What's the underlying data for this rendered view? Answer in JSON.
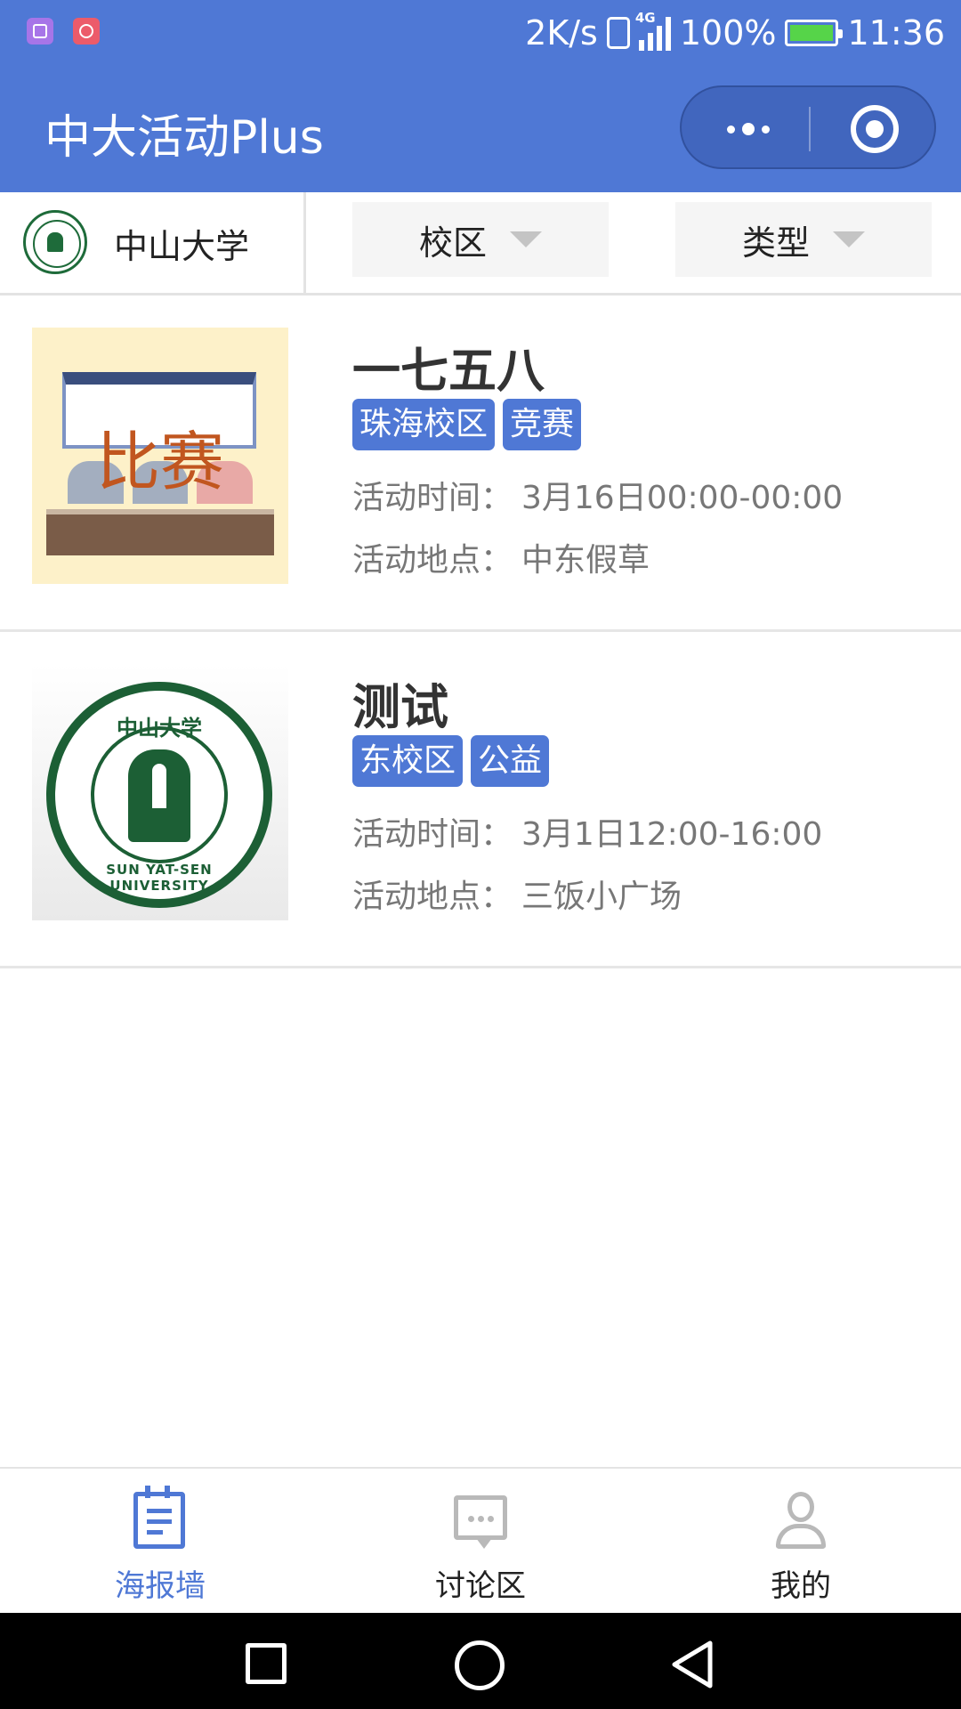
{
  "status_bar": {
    "speed": "2K/s",
    "network": "4G",
    "battery": "100%",
    "time": "11:36"
  },
  "nav_bar": {
    "title": "中大活动Plus"
  },
  "filter_bar": {
    "school": "中山大学",
    "campus_label": "校区",
    "type_label": "类型"
  },
  "events": [
    {
      "title": "一七五八",
      "tags": [
        "珠海校区",
        "竞赛"
      ],
      "time_label": "活动时间：",
      "time_value": "3月16日00:00-00:00",
      "place_label": "活动地点：",
      "place_value": "中东假草",
      "thumbnail_text": "比赛"
    },
    {
      "title": "测试",
      "tags": [
        "东校区",
        "公益"
      ],
      "time_label": "活动时间：",
      "time_value": "3月1日12:00-16:00",
      "place_label": "活动地点：",
      "place_value": "三饭小广场",
      "thumbnail_text_top": "中山大学",
      "thumbnail_text_bottom": "SUN YAT-SEN UNIVERSITY"
    }
  ],
  "tab_bar": {
    "tabs": [
      {
        "label": "海报墙",
        "icon": "poster-icon",
        "active": true
      },
      {
        "label": "讨论区",
        "icon": "chat-icon",
        "active": false
      },
      {
        "label": "我的",
        "icon": "user-icon",
        "active": false
      }
    ]
  },
  "colors": {
    "accent": "#4f78d5",
    "tag_bg": "#4f78d5",
    "divider": "#e6e6e6",
    "inactive_icon": "#b9b9b9"
  }
}
